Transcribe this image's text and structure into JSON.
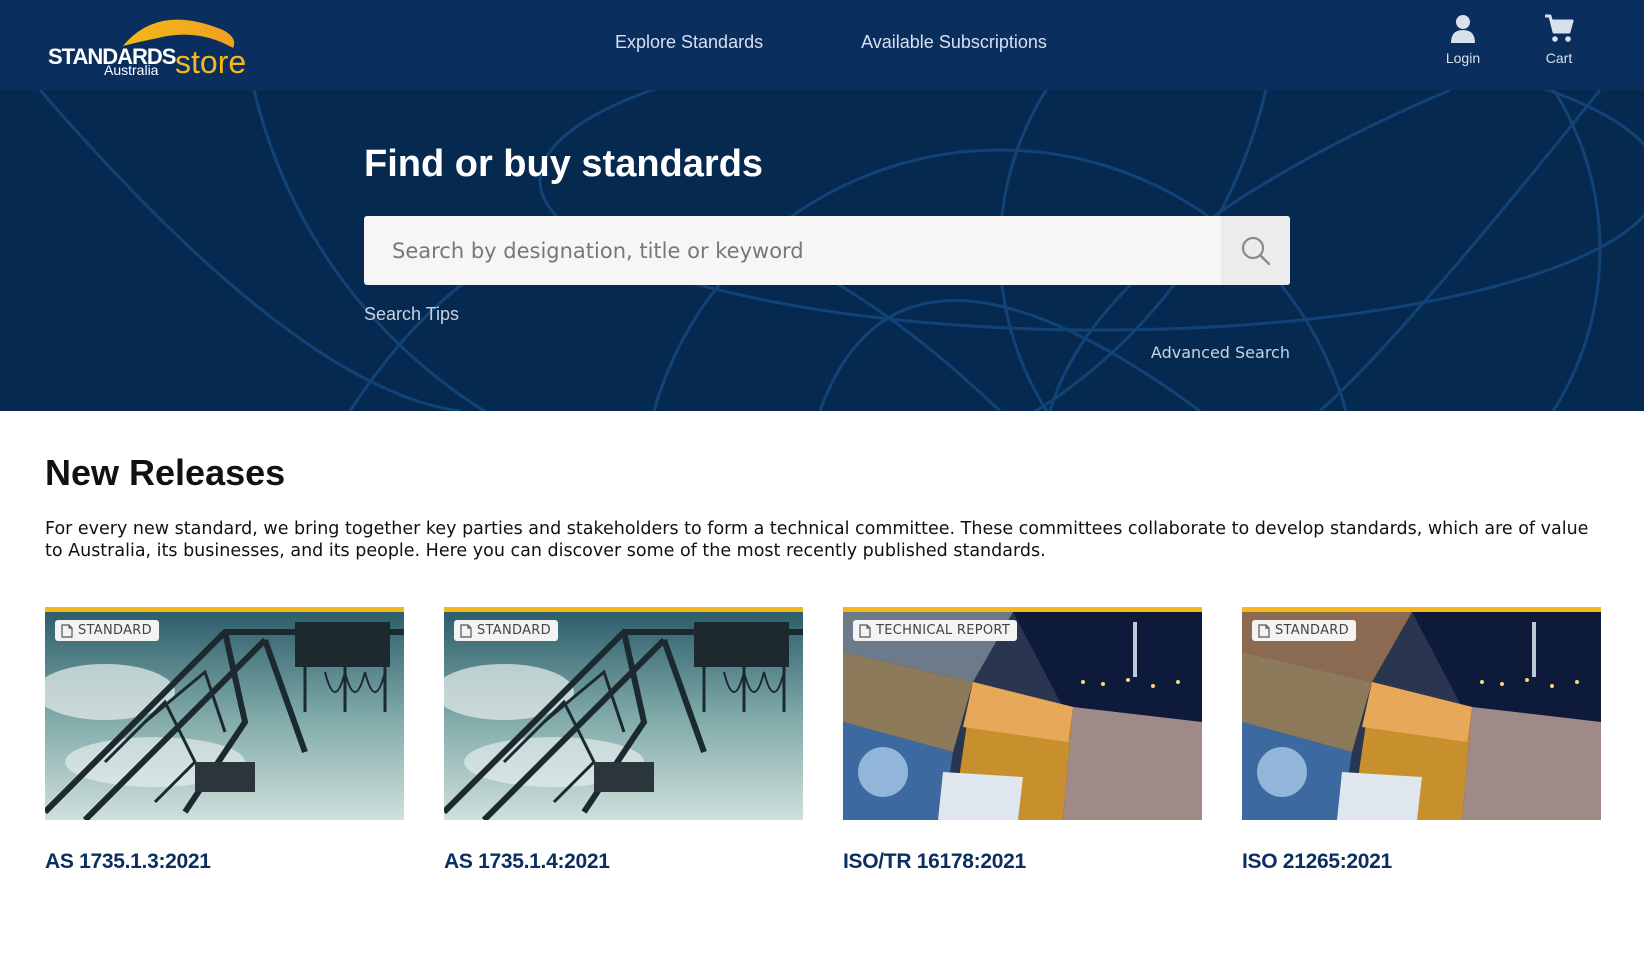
{
  "header": {
    "logo": {
      "line1": "STANDARDS",
      "line2": "Australia",
      "line3": "store"
    },
    "nav": [
      {
        "label": "Explore Standards"
      },
      {
        "label": "Available Subscriptions"
      }
    ],
    "login_label": "Login",
    "cart_label": "Cart"
  },
  "hero": {
    "title": "Find or buy standards",
    "search_placeholder": "Search by designation, title or keyword",
    "search_tips": "Search Tips",
    "advanced_search": "Advanced Search"
  },
  "new_releases": {
    "title": "New Releases",
    "description": "For every new standard, we bring together key parties and stakeholders to form a technical committee. These committees collaborate to develop standards, which are of value to Australia, its businesses, and its people. Here you can discover some of the most recently published standards.",
    "cards": [
      {
        "badge": "STANDARD",
        "title": "AS 1735.1.3:2021",
        "image": "crane"
      },
      {
        "badge": "STANDARD",
        "title": "AS 1735.1.4:2021",
        "image": "crane"
      },
      {
        "badge": "TECHNICAL REPORT",
        "title": "ISO/TR 16178:2021",
        "image": "collage"
      },
      {
        "badge": "STANDARD",
        "title": "ISO 21265:2021",
        "image": "collage"
      }
    ]
  },
  "colors": {
    "header_bg": "#0a2f5f",
    "hero_bg": "#06294f",
    "accent": "#f5b818",
    "card_title": "#0a2f5f"
  }
}
